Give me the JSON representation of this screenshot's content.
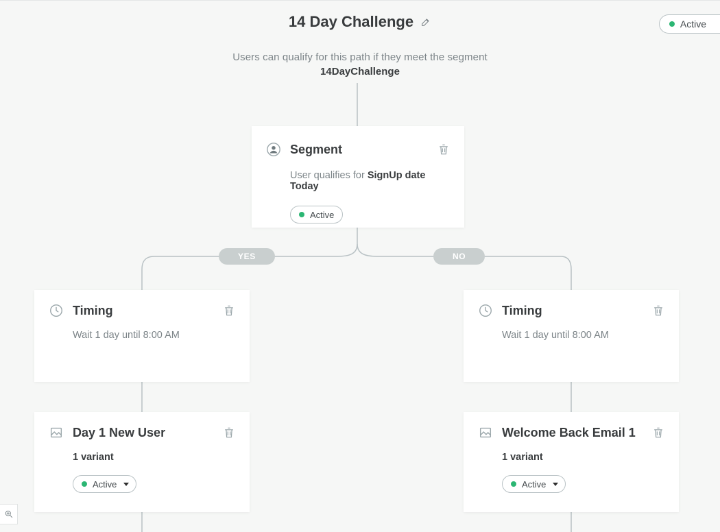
{
  "header": {
    "title": "14 Day Challenge",
    "subtitle": "Users can qualify for this path if they meet the segment",
    "segment_name": "14DayChallenge"
  },
  "top_status": "Active",
  "branches": {
    "yes_label": "YES",
    "no_label": "NO"
  },
  "segment_card": {
    "title": "Segment",
    "body_pre": "User qualifies for ",
    "body_strong": "SignUp date Today",
    "status": "Active"
  },
  "timing_left": {
    "title": "Timing",
    "body": "Wait 1 day until 8:00 AM"
  },
  "timing_right": {
    "title": "Timing",
    "body": "Wait 1 day until 8:00 AM"
  },
  "msg_left": {
    "title": "Day 1 New User",
    "variant": "1 variant",
    "status": "Active"
  },
  "msg_right": {
    "title": "Welcome Back Email 1",
    "variant": "1 variant",
    "status": "Active"
  }
}
